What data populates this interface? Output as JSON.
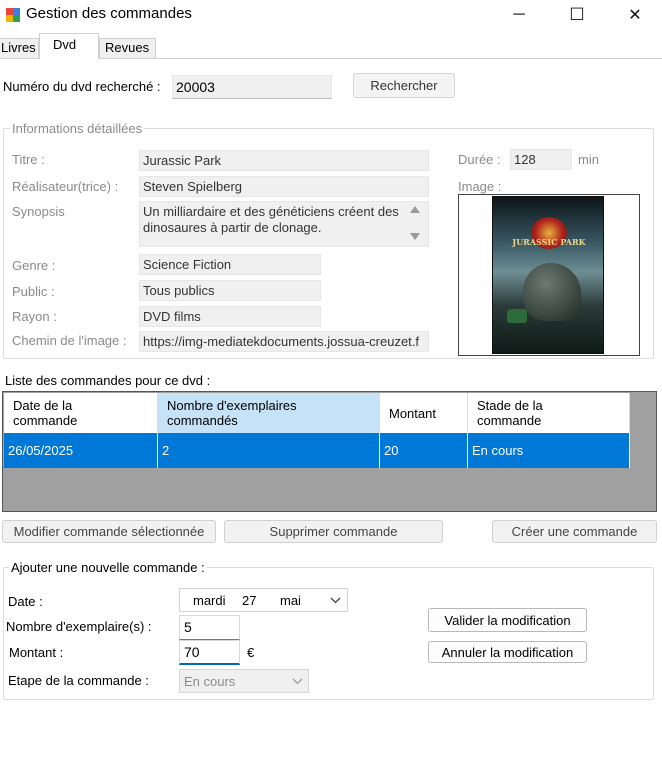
{
  "window": {
    "title": "Gestion des commandes",
    "minimize_glyph": "─",
    "maximize_glyph": "☐",
    "close_glyph": "✕"
  },
  "tabs": [
    {
      "label": "Livres"
    },
    {
      "label": "Dvd"
    },
    {
      "label": "Revues"
    }
  ],
  "search": {
    "label": "Numéro du dvd recherché :",
    "value": "20003",
    "button": "Rechercher"
  },
  "details": {
    "legend": "Informations détaillées",
    "titre_label": "Titre :",
    "titre": "Jurassic Park",
    "realisateur_label": "Réalisateur(trice) :",
    "realisateur": "Steven Spielberg",
    "synopsis_label": "Synopsis",
    "synopsis": "Un milliardaire et des généticiens créent des dinosaures à partir de clonage.",
    "genre_label": "Genre :",
    "genre": "Science Fiction",
    "public_label": "Public :",
    "public": "Tous publics",
    "rayon_label": "Rayon :",
    "rayon": "DVD films",
    "chemin_label": "Chemin de l'image :",
    "chemin": "https://img-mediatekdocuments.jossua-creuzet.f",
    "duree_label": "Durée :",
    "duree": "128",
    "duree_unit": "min",
    "image_label": "Image :",
    "poster_caption": "JURASSIC PARK"
  },
  "orders": {
    "title": "Liste des commandes pour ce dvd :",
    "columns": [
      {
        "line1": "Date de la",
        "line2": "commande"
      },
      {
        "line1": "Nombre d'exemplaires",
        "line2": "commandés"
      },
      {
        "line1": "Montant",
        "line2": ""
      },
      {
        "line1": "Stade de la",
        "line2": "commande"
      }
    ],
    "rows": [
      {
        "date": "26/05/2025",
        "nombre": "2",
        "montant": "20",
        "stade": "En cours"
      }
    ]
  },
  "actions": {
    "modifier": "Modifier commande sélectionnée",
    "supprimer": "Supprimer commande",
    "creer": "Créer une commande"
  },
  "form": {
    "legend": "Ajouter une nouvelle commande :",
    "date_label": "Date :",
    "date_day": "mardi",
    "date_num": "27",
    "date_month": "mai",
    "nombre_label": "Nombre d'exemplaire(s) :",
    "nombre": "5",
    "montant_label": "Montant :",
    "montant": "70",
    "currency": "€",
    "etape_label": "Etape de la commande :",
    "etape": "En cours",
    "valider": "Valider la modification",
    "annuler": "Annuler la modification"
  },
  "colors": {
    "selection": "#0078d7",
    "selected_header": "#c6e2f6",
    "focus_accent": "#0067c0"
  }
}
